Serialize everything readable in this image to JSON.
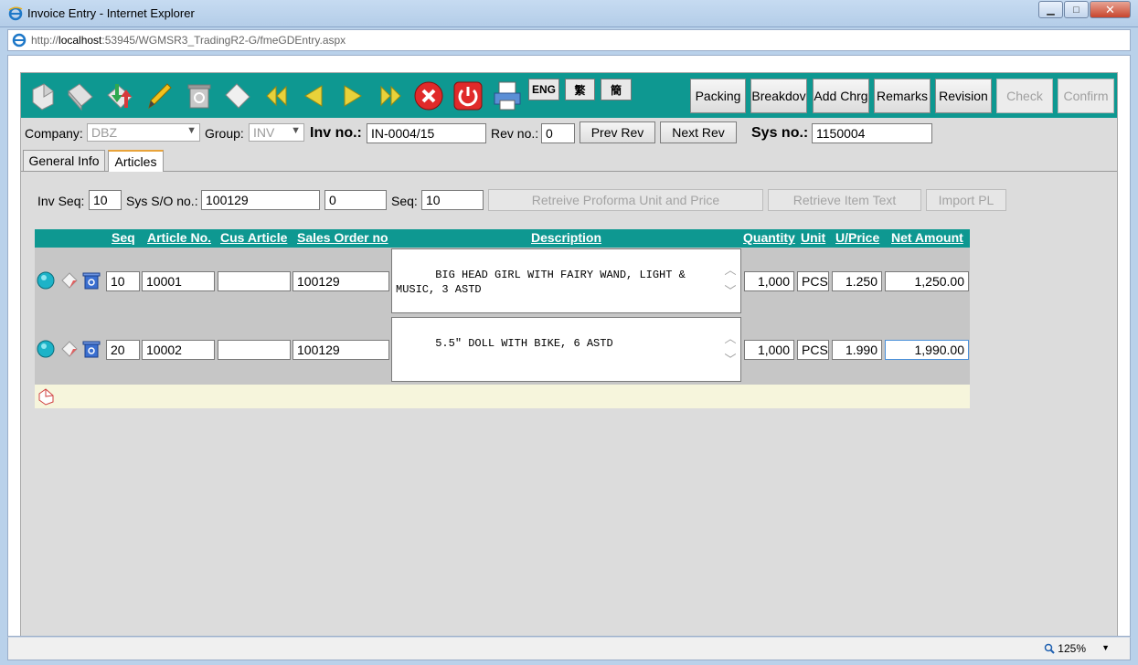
{
  "window": {
    "title": "Invoice Entry - Internet Explorer",
    "url_prefix": "http://",
    "url_host": "localhost",
    "url_rest": ":53945/WGMSR3_TradingR2-G/fmeGDEntry.aspx",
    "zoom": "125%"
  },
  "toolbar": {
    "icons": [
      "new-icon",
      "copy-icon",
      "import-export-icon",
      "edit-pencil-icon",
      "recycle-bin-icon",
      "clear-icon",
      "first-record-icon",
      "previous-record-icon",
      "next-record-icon",
      "last-record-icon",
      "cancel-icon",
      "power-exit-icon",
      "print-icon"
    ],
    "lang_eng": "ENG",
    "lang_trad": "繁",
    "lang_simp": "簡",
    "buttons": {
      "packing": "Packing",
      "breakdown": "Breakdov",
      "add_charge": "Add Chrg",
      "remarks": "Remarks",
      "revision": "Revision",
      "check": "Check",
      "confirm": "Confirm"
    }
  },
  "header": {
    "company_label": "Company:",
    "company_value": "DBZ",
    "group_label": "Group:",
    "group_value": "INV",
    "inv_no_label": "Inv no.:",
    "inv_no_value": "IN-0004/15",
    "rev_no_label": "Rev no.:",
    "rev_no_value": "0",
    "prev_rev": "Prev Rev",
    "next_rev": "Next Rev",
    "sys_no_label": "Sys no.:",
    "sys_no_value": "1150004"
  },
  "tabs": [
    "General Info",
    "Articles"
  ],
  "articles": {
    "inv_seq_label": "Inv Seq:",
    "inv_seq_value": "10",
    "sys_so_label": "Sys S/O no.:",
    "sys_so_value": "100129",
    "sys_so_extra": "0",
    "seq_label": "Seq:",
    "seq_value": "10",
    "retrieve_price": "Retreive Proforma Unit and Price",
    "retrieve_text": "Retrieve Item Text",
    "import_pl": "Import PL"
  },
  "grid": {
    "columns": {
      "seq": "Seq",
      "article_no": "Article No.",
      "cus_article": "Cus Article",
      "sales_order": "Sales Order no",
      "description": "Description",
      "quantity": "Quantity",
      "unit": "Unit",
      "uprice": "U/Price",
      "net_amount": "Net Amount"
    },
    "rows": [
      {
        "seq": "10",
        "article_no": "10001",
        "cus_article": "",
        "sales_order": "100129",
        "description": "BIG HEAD GIRL WITH FAIRY WAND, LIGHT &\nMUSIC, 3 ASTD",
        "quantity": "1,000",
        "unit": "PCS",
        "uprice": "1.250",
        "net_amount": "1,250.00"
      },
      {
        "seq": "20",
        "article_no": "10002",
        "cus_article": "",
        "sales_order": "100129",
        "description": "5.5\" DOLL WITH BIKE, 6 ASTD",
        "quantity": "1,000",
        "unit": "PCS",
        "uprice": "1.990",
        "net_amount": "1,990.00"
      }
    ]
  },
  "colors": {
    "accent_teal": "#0e9891",
    "panel_gray": "#dcdcdc",
    "row_gray": "#c6c6c6",
    "footer_cream": "#f6f5dc"
  }
}
